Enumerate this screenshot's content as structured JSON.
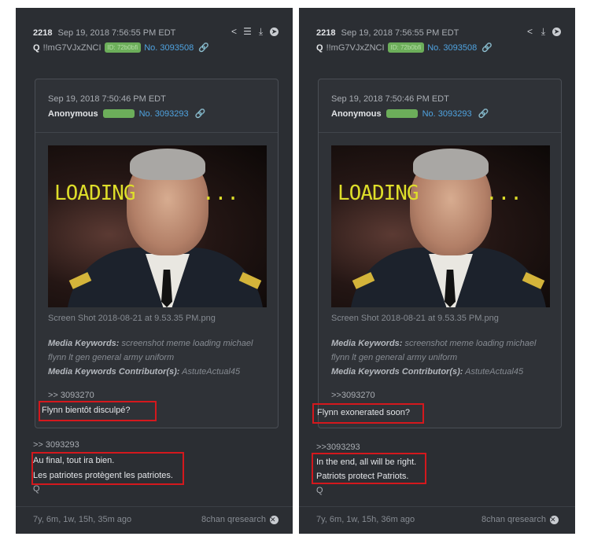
{
  "left": {
    "post_number": "2218",
    "post_date": "Sep 19, 2018 7:56:55 PM EDT",
    "author": "Q",
    "tripcode": "!!mG7VJxZNCI",
    "id_badge": "ID: 72b0bfi",
    "post_link": "No. 3093508",
    "inner": {
      "date": "Sep 19, 2018 7:50:46 PM EDT",
      "name": "Anonymous",
      "post_link": "No. 3093293",
      "filename": "Screen Shot 2018-08-21 at 9.53.35 PM.png",
      "image_text": "LOADING",
      "image_dots": "...",
      "media_keywords_label": "Media Keywords:",
      "media_keywords": "screenshot meme loading michael flynn lt gen general army uniform",
      "contributor_label": "Media Keywords Contributor(s):",
      "contributor": "AstuteActual45",
      "ref": ">> 3093270",
      "question": "Flynn bientôt disculpé?"
    },
    "ref": ">> 3093293",
    "answer_line1": "Au final, tout ira bien.",
    "answer_line2": "Les patriotes protègent les patriotes.",
    "signature": "Q",
    "age": "7y, 6m, 1w, 15h, 35m ago",
    "source": "8chan qresearch"
  },
  "right": {
    "post_number": "2218",
    "post_date": "Sep 19, 2018 7:56:55 PM EDT",
    "author": "Q",
    "tripcode": "!!mG7VJxZNCI",
    "id_badge": "ID: 72b0bfi",
    "post_link": "No. 3093508",
    "inner": {
      "date": "Sep 19, 2018 7:50:46 PM EDT",
      "name": "Anonymous",
      "post_link": "No. 3093293",
      "filename": "Screen Shot 2018-08-21 at 9.53.35 PM.png",
      "image_text": "LOADING",
      "image_dots": "...",
      "media_keywords_label": "Media Keywords:",
      "media_keywords": "screenshot meme loading michael flynn lt gen general army uniform",
      "contributor_label": "Media Keywords Contributor(s):",
      "contributor": "AstuteActual45",
      "ref": ">>3093270",
      "question": "Flynn exonerated soon?"
    },
    "ref": ">>3093293",
    "answer_line1": "In the end, all will be right.",
    "answer_line2": "Patriots protect Patriots.",
    "signature": "Q",
    "age": "7y, 6m, 1w, 15h, 36m ago",
    "source": "8chan qresearch"
  },
  "icons": {
    "share": "share-icon",
    "flag": "flag-icon",
    "download": "download-icon",
    "go": "arrow-right-circle-icon",
    "link": "link-icon",
    "close": "close-circle-icon"
  },
  "colors": {
    "panel_bg": "#2b2e33",
    "link": "#4fa3e0",
    "id_badge": "#6cae5a",
    "highlight_box": "#d4181d",
    "loading_text": "#dede2a"
  }
}
